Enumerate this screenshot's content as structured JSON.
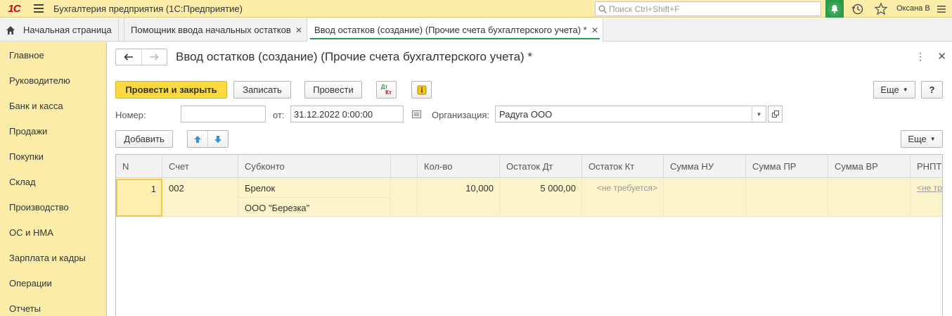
{
  "app": {
    "logo": "1С",
    "title": "Бухгалтерия предприятия  (1С:Предприятие)",
    "search_placeholder": "Поиск Ctrl+Shift+F",
    "user": "Оксана В"
  },
  "tabs": [
    {
      "label": "Начальная страница"
    },
    {
      "label": "Помощник ввода начальных остатков"
    },
    {
      "label": "Ввод остатков (создание) (Прочие счета бухгалтерского учета) *"
    }
  ],
  "sidebar": {
    "items": [
      {
        "label": "Главное"
      },
      {
        "label": "Руководителю"
      },
      {
        "label": "Банк и касса"
      },
      {
        "label": "Продажи"
      },
      {
        "label": "Покупки"
      },
      {
        "label": "Склад"
      },
      {
        "label": "Производство"
      },
      {
        "label": "ОС и НМА"
      },
      {
        "label": "Зарплата и кадры"
      },
      {
        "label": "Операции"
      },
      {
        "label": "Отчеты"
      }
    ]
  },
  "document": {
    "title": "Ввод остатков (создание) (Прочие счета бухгалтерского учета) *",
    "toolbar": {
      "post_close": "Провести и закрыть",
      "save": "Записать",
      "post": "Провести",
      "dt_kt_top": "Дт",
      "dt_kt_bottom": "Кт",
      "more": "Еще",
      "help": "?"
    },
    "fields": {
      "number_label": "Номер:",
      "number_value": "",
      "date_label": "от:",
      "date_value": "31.12.2022  0:00:00",
      "org_label": "Организация:",
      "org_value": "Радуга ООО"
    },
    "table_toolbar": {
      "add": "Добавить",
      "more": "Еще"
    },
    "table": {
      "columns": [
        "N",
        "Счет",
        "Субконто",
        "",
        "Кол-во",
        "Остаток Дт",
        "Остаток Кт",
        "Сумма НУ",
        "Сумма ПР",
        "Сумма ВР",
        "РНПТ"
      ],
      "rows": [
        {
          "n": "1",
          "account": "002",
          "subconto1": "Брелок",
          "subconto2": "ООО \"Березка\"",
          "qty": "10,000",
          "balance_dt": "5 000,00",
          "balance_kt": "<не требуется>",
          "rnpt": "<не тр"
        }
      ]
    }
  },
  "colors": {
    "accent_yellow": "#fbeda8",
    "primary_button": "#fbd940",
    "green": "#2e9b4b",
    "logo_red": "#d0021b"
  }
}
